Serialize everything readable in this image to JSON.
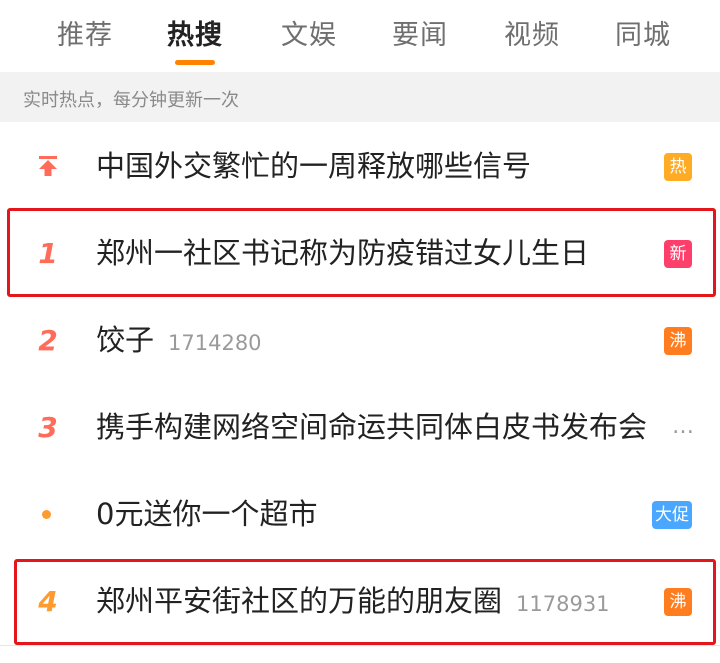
{
  "tabs": [
    {
      "label": "推荐",
      "active": false
    },
    {
      "label": "热搜",
      "active": true
    },
    {
      "label": "文娱",
      "active": false
    },
    {
      "label": "要闻",
      "active": false
    },
    {
      "label": "视频",
      "active": false
    },
    {
      "label": "同城",
      "active": false
    }
  ],
  "subheader": {
    "text": "实时热点，每分钟更新一次"
  },
  "items": [
    {
      "rank": "",
      "rank_icon": "pin-top-icon",
      "title": "中国外交繁忙的一周释放哪些信号",
      "count": "",
      "badge": "热",
      "badge_type": "hot"
    },
    {
      "rank": "1",
      "title": "郑州一社区书记称为防疫错过女儿生日",
      "count": "",
      "badge": "新",
      "badge_type": "new"
    },
    {
      "rank": "2",
      "title": "饺子",
      "count": "1714280",
      "badge": "沸",
      "badge_type": "boil"
    },
    {
      "rank": "3",
      "title": "携手构建网络空间命运共同体白皮书发布会",
      "count": "",
      "badge": "",
      "badge_type": "",
      "truncated": true
    },
    {
      "rank": "",
      "rank_icon": "dot-icon",
      "title": "0元送你一个超市",
      "count": "",
      "badge": "大促",
      "badge_type": "promo"
    },
    {
      "rank": "4",
      "title": "郑州平安街社区的万能的朋友圈",
      "count": "1178931",
      "badge": "沸",
      "badge_type": "boil"
    }
  ],
  "more_indicator": "…",
  "colors": {
    "accent": "#ff8200",
    "rank_red": "#ff6c5a",
    "rank_orange": "#ff9a2e",
    "badge_hot": "#ffab24",
    "badge_new": "#ff3f6b",
    "badge_boil": "#ff7c1f",
    "badge_promo": "#4aa7ff",
    "highlight_box": "#e4151b"
  }
}
